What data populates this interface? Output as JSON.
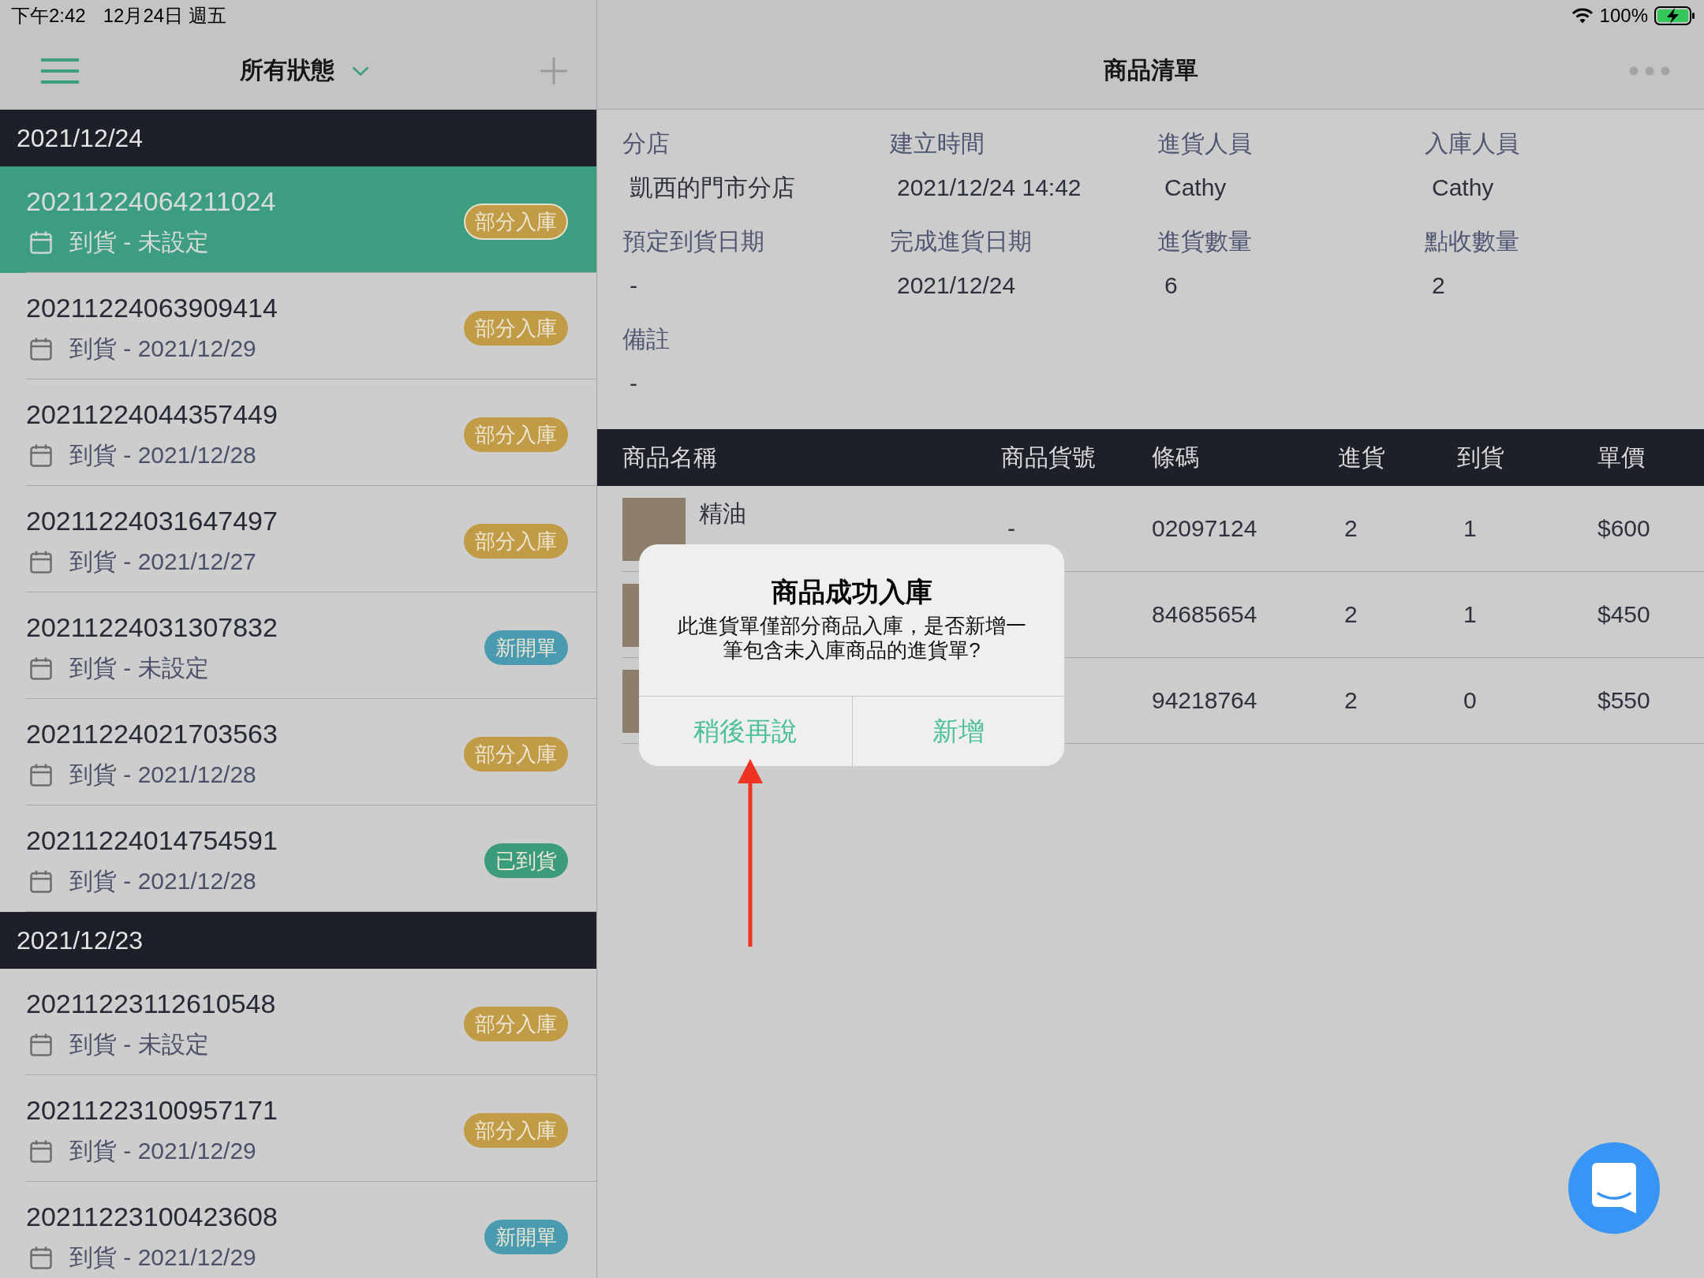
{
  "status_bar": {
    "time": "下午2:42",
    "date": "12月24日 週五",
    "battery": "100%",
    "charging": true
  },
  "list_header": {
    "filter": "所有狀態"
  },
  "groups": [
    {
      "date": "2021/12/24",
      "orders": [
        {
          "number": "20211224064211024",
          "arrival": "到貨 - 未設定",
          "status": "部分入庫",
          "color": "#c19b45",
          "selected": true
        },
        {
          "number": "20211224063909414",
          "arrival": "到貨 - 2021/12/29",
          "status": "部分入庫",
          "color": "#c19b45",
          "selected": false
        },
        {
          "number": "20211224044357449",
          "arrival": "到貨 - 2021/12/28",
          "status": "部分入庫",
          "color": "#c19b45",
          "selected": false
        },
        {
          "number": "20211224031647497",
          "arrival": "到貨 - 2021/12/27",
          "status": "部分入庫",
          "color": "#c19b45",
          "selected": false
        },
        {
          "number": "20211224031307832",
          "arrival": "到貨 - 未設定",
          "status": "新開單",
          "color": "#4a9bb0",
          "selected": false
        },
        {
          "number": "20211224021703563",
          "arrival": "到貨 - 2021/12/28",
          "status": "部分入庫",
          "color": "#c19b45",
          "selected": false
        },
        {
          "number": "20211224014754591",
          "arrival": "到貨 - 2021/12/28",
          "status": "已到貨",
          "color": "#3b9c7d",
          "selected": false
        }
      ]
    },
    {
      "date": "2021/12/23",
      "orders": [
        {
          "number": "20211223112610548",
          "arrival": "到貨 - 未設定",
          "status": "部分入庫",
          "color": "#c19b45",
          "selected": false
        },
        {
          "number": "20211223100957171",
          "arrival": "到貨 - 2021/12/29",
          "status": "部分入庫",
          "color": "#c19b45",
          "selected": false
        },
        {
          "number": "20211223100423608",
          "arrival": "到貨 - 2021/12/29",
          "status": "新開單",
          "color": "#4a9bb0",
          "selected": false
        }
      ]
    }
  ],
  "detail": {
    "title": "商品清單",
    "fields": [
      {
        "label": "分店",
        "value": "凱西的門市分店"
      },
      {
        "label": "建立時間",
        "value": "2021/12/24 14:42"
      },
      {
        "label": "進貨人員",
        "value": "Cathy"
      },
      {
        "label": "入庫人員",
        "value": "Cathy"
      },
      {
        "label": "預定到貨日期",
        "value": "-"
      },
      {
        "label": "完成進貨日期",
        "value": "2021/12/24"
      },
      {
        "label": "進貨數量",
        "value": "6"
      },
      {
        "label": "點收數量",
        "value": "2"
      },
      {
        "label": "備註",
        "value": "-"
      }
    ],
    "table": {
      "columns": [
        "商品名稱",
        "商品貨號",
        "條碼",
        "進貨",
        "到貨",
        "單價"
      ],
      "rows": [
        {
          "name": "精油",
          "sku": "-",
          "barcode": "02097124",
          "ordered": "2",
          "received": "1",
          "price": "$600"
        },
        {
          "barcode": "84685654",
          "ordered": "2",
          "received": "1",
          "price": "$450"
        },
        {
          "barcode": "94218764",
          "ordered": "2",
          "received": "0",
          "price": "$550"
        }
      ]
    }
  },
  "dialog": {
    "title": "商品成功入庫",
    "message": "此進貨單僅部分商品入庫，是否新增一筆包含未入庫商品的進貨單?",
    "buttons": [
      "稍後再說",
      "新增"
    ]
  },
  "annotation": {
    "kind": "arrow"
  }
}
